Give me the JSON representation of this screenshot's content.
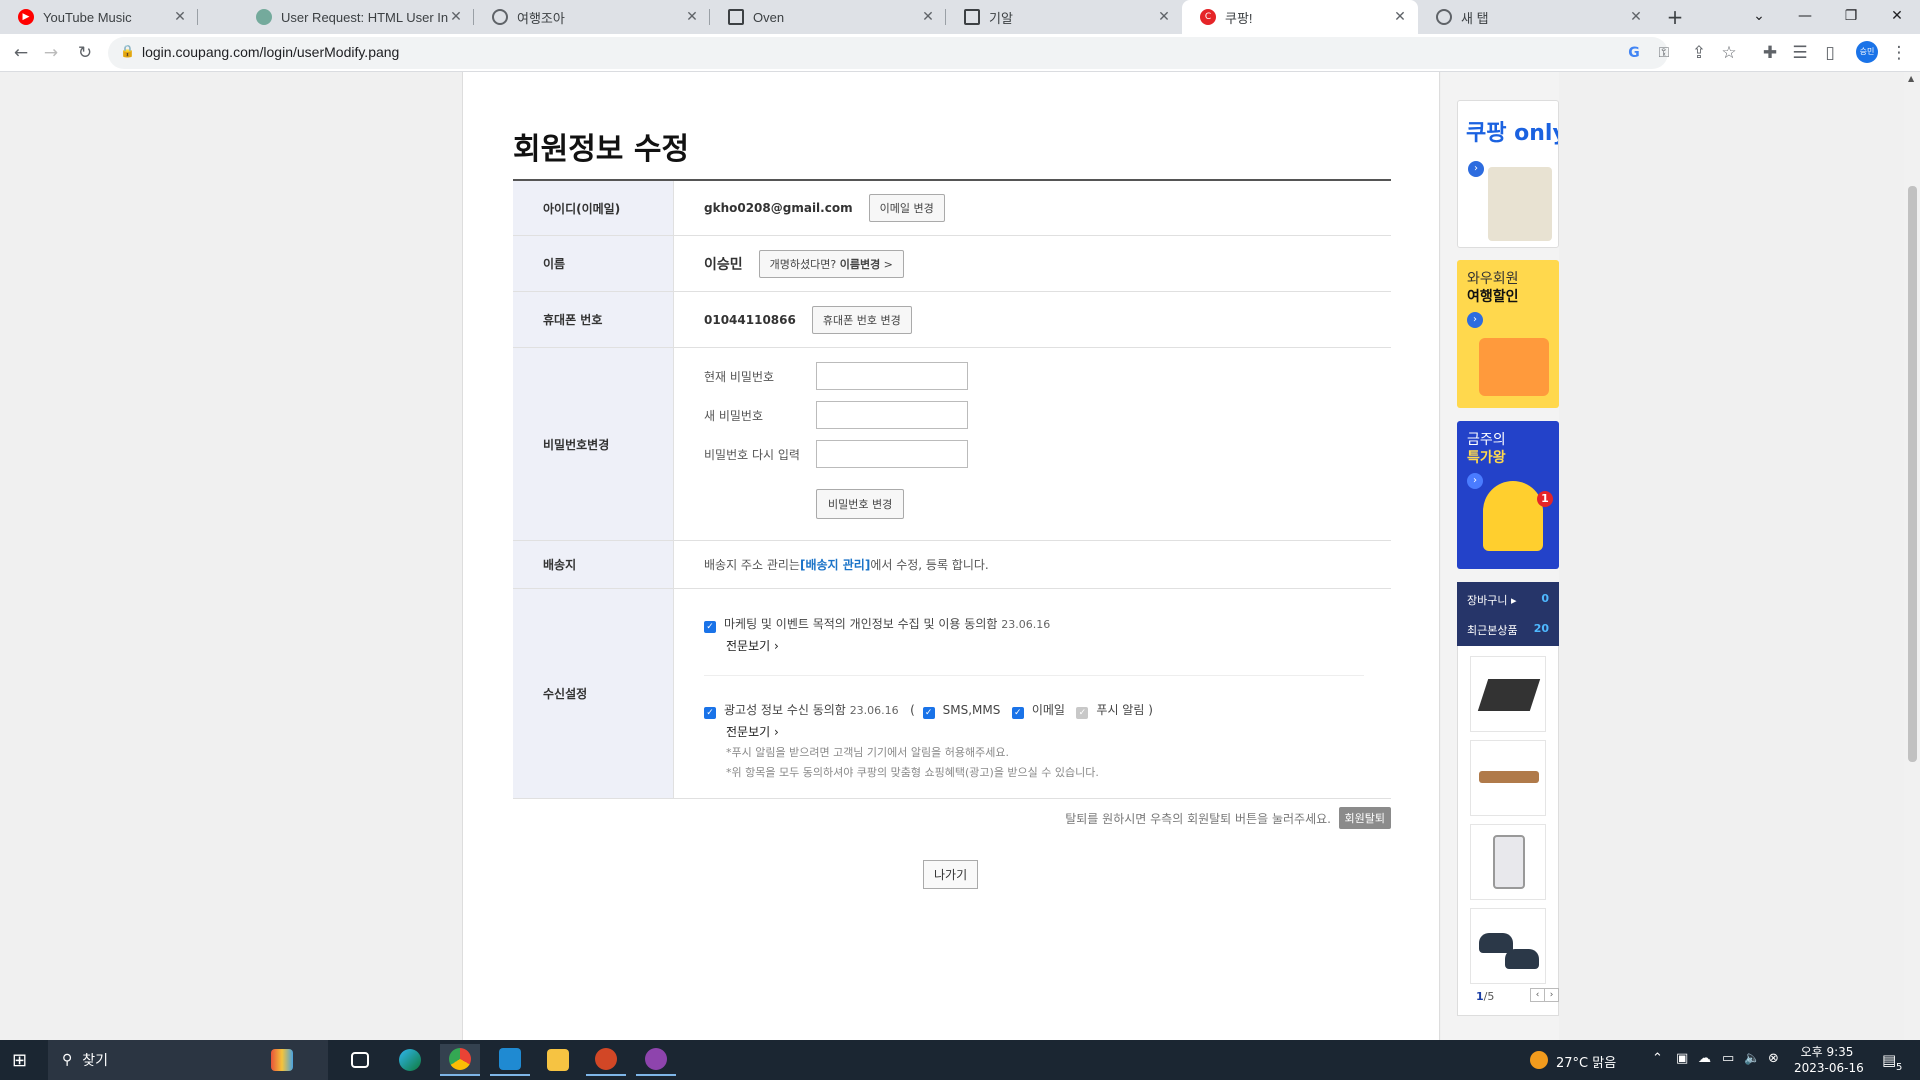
{
  "browser": {
    "tabs": [
      {
        "title": "YouTube Music",
        "favicon": "youtube-music-icon",
        "color": "#ff0000",
        "active": false
      },
      {
        "title": "User Request: HTML User Infor",
        "favicon": "chatgpt-icon",
        "color": "#74aa9c",
        "active": false
      },
      {
        "title": "여행조아",
        "favicon": "globe-icon",
        "color": "#5f6368",
        "active": false
      },
      {
        "title": "Oven",
        "favicon": "oven-icon",
        "color": "#3c4043",
        "active": false
      },
      {
        "title": "기알",
        "favicon": "oven-icon",
        "color": "#3c4043",
        "active": false
      },
      {
        "title": "쿠팡!",
        "favicon": "coupang-icon",
        "color": "#e52528",
        "active": true
      },
      {
        "title": "새 탭",
        "favicon": "globe-icon",
        "color": "#5f6368",
        "active": false
      }
    ],
    "new_tab_label": "+",
    "url": "login.coupang.com/login/userModify.pang",
    "profile_label": "승민"
  },
  "page": {
    "heading": "회원정보 수정",
    "rows": {
      "id": {
        "label": "아이디(이메일)",
        "value": "gkho0208@gmail.com",
        "button": "이메일 변경"
      },
      "name": {
        "label": "이름",
        "value": "이승민",
        "button_prefix": "개명하셨다면? ",
        "button_main": "이름변경",
        "button_suffix": " >"
      },
      "phone": {
        "label": "휴대폰 번호",
        "value": "01044110866",
        "button": "휴대폰 번호 변경"
      },
      "password": {
        "label": "비밀번호변경",
        "current": "현재 비밀번호",
        "new": "새 비밀번호",
        "confirm": "비밀번호 다시 입력",
        "button": "비밀번호 변경"
      },
      "address": {
        "label": "배송지",
        "text_before": "배송지 주소 관리는 ",
        "link": "[배송지 관리]",
        "text_after": "에서 수정, 등록 합니다."
      },
      "consent": {
        "label": "수신설정",
        "marketing": {
          "text": "마케팅 및 이벤트 목적의 개인정보 수집 및 이용 동의함",
          "date": "23.06.16",
          "checked": true
        },
        "more1": "전문보기",
        "ads": {
          "text": "광고성 정보 수신 동의함",
          "date": "23.06.16",
          "checked": true
        },
        "channels_open": "(",
        "sms": {
          "label": "SMS,MMS",
          "checked": true
        },
        "email": {
          "label": "이메일",
          "checked": true
        },
        "push": {
          "label": "푸시 알림",
          "checked": true,
          "disabled": true
        },
        "channels_close": ")",
        "more2": "전문보기",
        "note1": "*푸시 알림을 받으려면 고객님 기기에서 알림을 허용해주세요.",
        "note2": "*위 항목을 모두 동의하셔야 쿠팡의 맞춤형 쇼핑혜택(광고)을 받으실 수 있습니다."
      }
    },
    "withdraw_text": "탈퇴를 원하시면 우측의 회원탈퇴 버튼을 눌러주세요.",
    "withdraw_button": "회원탈퇴",
    "exit_button": "나가기"
  },
  "sidebar": {
    "banner1": {
      "title": "쿠팡 only"
    },
    "banner2": {
      "line1": "와우회원",
      "line2": "여행할인"
    },
    "banner3": {
      "line1": "금주의",
      "line2": "특가왕",
      "badge": "1"
    },
    "cart_label": "장바구니 ▸",
    "cart_count": "0",
    "recent_label": "최근본상품",
    "recent_count": "20",
    "products": [
      "laptop-thumbnail",
      "wooden-gun-model-thumbnail",
      "tablet-thumbnail",
      "shoes-thumbnail"
    ],
    "pager_current": "1",
    "pager_total": "/5"
  },
  "taskbar": {
    "search_label": "찾기",
    "weather": "27°C  맑음",
    "time": "오후 9:35",
    "date": "2023-06-16",
    "notifications": "5"
  },
  "colors": {
    "accent": "#1a73e8",
    "label_bg": "#eef0f8",
    "taskbar": "#1b2632"
  }
}
